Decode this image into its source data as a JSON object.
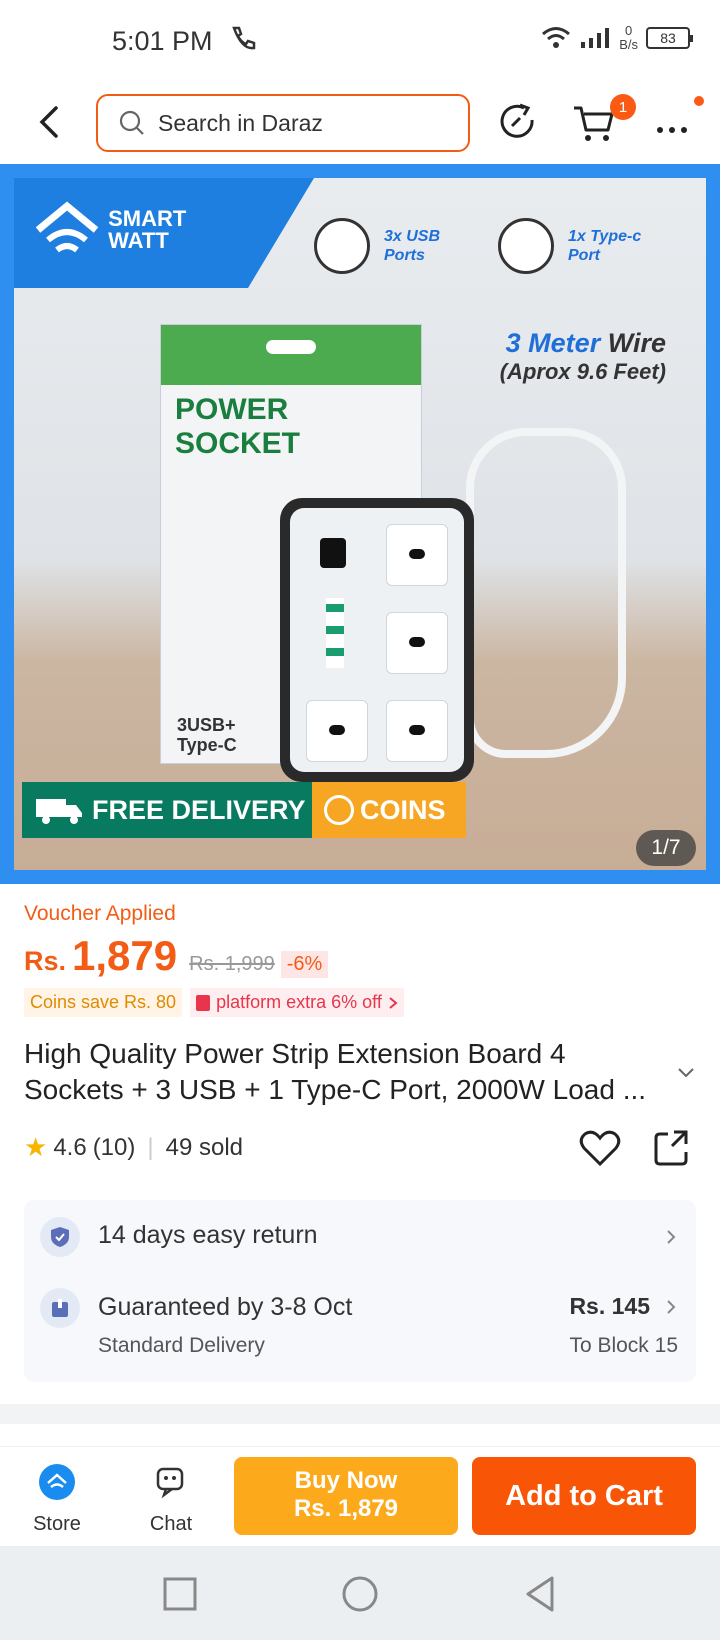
{
  "status": {
    "time": "5:01 PM",
    "net_speed_value": "0",
    "net_speed_unit": "B/s",
    "battery": "83"
  },
  "header": {
    "search_placeholder": "Search in Daraz",
    "cart_count": "1"
  },
  "hero": {
    "brand": "SMART WATT",
    "feature1": "3x USB Ports",
    "feature2": "1x Type-c Port",
    "wire_accent": "3 Meter",
    "wire_main": "Wire",
    "wire_sub": "(Aprox 9.6 Feet)",
    "box_title": "POWER SOCKET",
    "box_sub": "3USB+ Type-C",
    "free_delivery": "FREE DELIVERY",
    "coins": "COINS",
    "counter": "1/7"
  },
  "product": {
    "voucher": "Voucher Applied",
    "currency": "Rs.",
    "price": "1,879",
    "old_price": "Rs. 1,999",
    "discount": "-6%",
    "coins_save": "Coins save Rs. 80",
    "platform_offer": "platform extra 6% off",
    "title": "High Quality Power Strip Extension Board 4 Sockets + 3 USB + 1 Type-C Port, 2000W Load ...",
    "rating": "4.6",
    "rating_count": "(10)",
    "sold": "49 sold"
  },
  "service": {
    "return": "14 days easy return",
    "delivery": "Guaranteed by 3-8 Oct",
    "delivery_type": "Standard Delivery",
    "delivery_fee": "Rs. 145",
    "delivery_to": "To Block 15"
  },
  "bottom": {
    "store": "Store",
    "chat": "Chat",
    "buy_now": "Buy Now",
    "buy_price": "Rs. 1,879",
    "add_to_cart": "Add to Cart"
  },
  "colors": {
    "accent": "#f85606",
    "buy": "#fcaa1c",
    "hero_blue": "#2f8ff0"
  }
}
